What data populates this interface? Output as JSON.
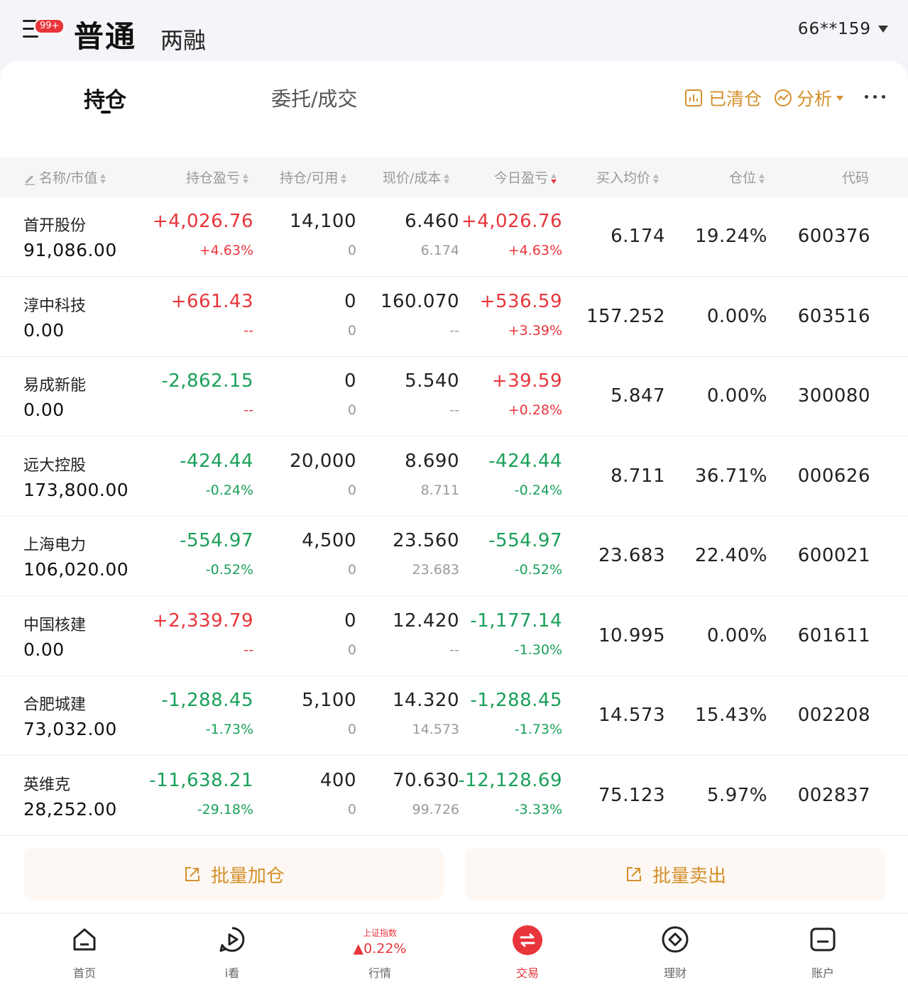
{
  "header": {
    "badge": "99+",
    "mode_active": "普通",
    "mode_other": "两融",
    "account": "66**159"
  },
  "tabs": {
    "holdings": "持仓",
    "orders": "委托/成交",
    "cleared": "已清仓",
    "analysis": "分析"
  },
  "columns": {
    "name": "名称/市值",
    "pnl": "持仓盈亏",
    "qty": "持仓/可用",
    "price": "现价/成本",
    "today": "今日盈亏",
    "avg": "买入均价",
    "position": "仓位",
    "code": "代码"
  },
  "rows": [
    {
      "name": "首开股份",
      "market_value": "91,086.00",
      "pnl": "+4,026.76",
      "pnl_pct": "+4.63%",
      "qty": "14,100",
      "avail": "0",
      "price": "6.460",
      "cost": "6.174",
      "today": "+4,026.76",
      "today_pct": "+4.63%",
      "avg": "6.174",
      "position": "19.24%",
      "code": "600376"
    },
    {
      "name": "淳中科技",
      "market_value": "0.00",
      "pnl": "+661.43",
      "pnl_pct": "--",
      "qty": "0",
      "avail": "0",
      "price": "160.070",
      "cost": "--",
      "today": "+536.59",
      "today_pct": "+3.39%",
      "avg": "157.252",
      "position": "0.00%",
      "code": "603516"
    },
    {
      "name": "易成新能",
      "market_value": "0.00",
      "pnl": "-2,862.15",
      "pnl_pct": "--",
      "qty": "0",
      "avail": "0",
      "price": "5.540",
      "cost": "--",
      "today": "+39.59",
      "today_pct": "+0.28%",
      "avg": "5.847",
      "position": "0.00%",
      "code": "300080"
    },
    {
      "name": "远大控股",
      "market_value": "173,800.00",
      "pnl": "-424.44",
      "pnl_pct": "-0.24%",
      "qty": "20,000",
      "avail": "0",
      "price": "8.690",
      "cost": "8.711",
      "today": "-424.44",
      "today_pct": "-0.24%",
      "avg": "8.711",
      "position": "36.71%",
      "code": "000626"
    },
    {
      "name": "上海电力",
      "market_value": "106,020.00",
      "pnl": "-554.97",
      "pnl_pct": "-0.52%",
      "qty": "4,500",
      "avail": "0",
      "price": "23.560",
      "cost": "23.683",
      "today": "-554.97",
      "today_pct": "-0.52%",
      "avg": "23.683",
      "position": "22.40%",
      "code": "600021"
    },
    {
      "name": "中国核建",
      "market_value": "0.00",
      "pnl": "+2,339.79",
      "pnl_pct": "--",
      "qty": "0",
      "avail": "0",
      "price": "12.420",
      "cost": "--",
      "today": "-1,177.14",
      "today_pct": "-1.30%",
      "avg": "10.995",
      "position": "0.00%",
      "code": "601611"
    },
    {
      "name": "合肥城建",
      "market_value": "73,032.00",
      "pnl": "-1,288.45",
      "pnl_pct": "-1.73%",
      "qty": "5,100",
      "avail": "0",
      "price": "14.320",
      "cost": "14.573",
      "today": "-1,288.45",
      "today_pct": "-1.73%",
      "avg": "14.573",
      "position": "15.43%",
      "code": "002208"
    },
    {
      "name": "英维克",
      "market_value": "28,252.00",
      "pnl": "-11,638.21",
      "pnl_pct": "-29.18%",
      "qty": "400",
      "avail": "0",
      "price": "70.630",
      "cost": "99.726",
      "today": "-12,128.69",
      "today_pct": "-3.33%",
      "avg": "75.123",
      "position": "5.97%",
      "code": "002837"
    }
  ],
  "buttons": {
    "batch_add": "批量加仓",
    "batch_sell": "批量卖出"
  },
  "tabbar": {
    "home": "首页",
    "watch": "i看",
    "market": "行情",
    "index_name": "上证指数",
    "index_change": "0.22%",
    "trade": "交易",
    "wealth": "理财",
    "account": "账户"
  },
  "colors": {
    "up": "#e8353b",
    "down": "#1aa05a",
    "accent": "#d4902c"
  }
}
